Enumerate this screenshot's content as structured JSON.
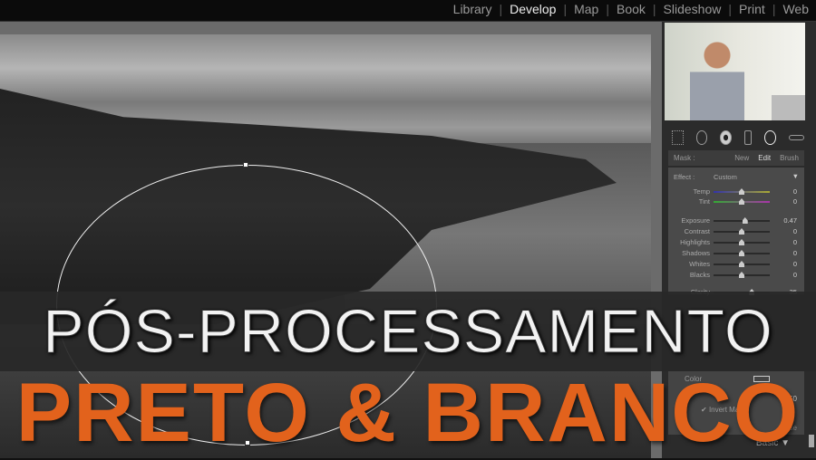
{
  "top_nav": {
    "modules": [
      "Library",
      "Develop",
      "Map",
      "Book",
      "Slideshow",
      "Print",
      "Web"
    ],
    "active": "Develop"
  },
  "mask": {
    "label": "Mask :",
    "new": "New",
    "edit": "Edit",
    "brush": "Brush"
  },
  "effect": {
    "label": "Effect :",
    "value": "Custom"
  },
  "sliders": [
    {
      "label": "Temp",
      "value": "0"
    },
    {
      "label": "Tint",
      "value": "0"
    },
    {
      "label": "Exposure",
      "value": "0.47"
    },
    {
      "label": "Contrast",
      "value": "0"
    },
    {
      "label": "Highlights",
      "value": "0"
    },
    {
      "label": "Shadows",
      "value": "0"
    },
    {
      "label": "Whites",
      "value": "0"
    },
    {
      "label": "Blacks",
      "value": "0"
    },
    {
      "label": "Clarity",
      "value": "35"
    }
  ],
  "lower": {
    "color_label": "Color",
    "feather_value": "50",
    "invert_mask": "Invert Mask",
    "close": "Close"
  },
  "basic_panel": "Basic",
  "title_line1": "PÓS-PROCESSAMENTO",
  "title_line2": "PRETO & BRANCO",
  "colors": {
    "accent_orange": "#e2621c",
    "panel": "#4a4a4a"
  }
}
